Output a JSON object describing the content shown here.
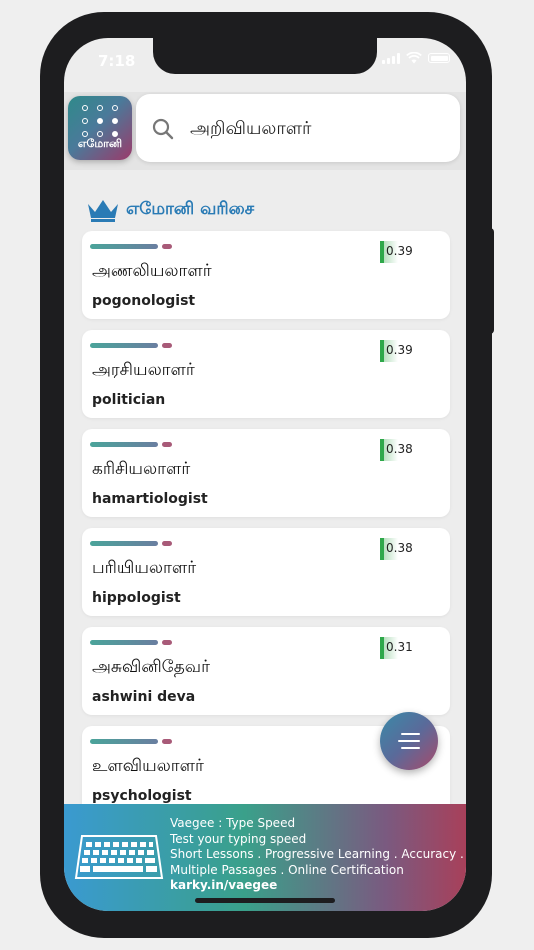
{
  "status_bar": {
    "time": "7:18"
  },
  "app": {
    "logo_text": "எமோனி"
  },
  "search": {
    "value": "அறிவியலாளர்"
  },
  "section": {
    "title": "எமோனி வரிசை"
  },
  "results": [
    {
      "word": "அணலியலாளர்",
      "translation": "pogonologist",
      "score": "0.39"
    },
    {
      "word": "அரசியலாளர்",
      "translation": "politician",
      "score": "0.39"
    },
    {
      "word": "கரிசியலாளர்",
      "translation": "hamartiologist",
      "score": "0.38"
    },
    {
      "word": "பரியியலாளர்",
      "translation": "hippologist",
      "score": "0.38"
    },
    {
      "word": "அசுவினிதேவர்",
      "translation": "ashwini deva",
      "score": "0.31"
    },
    {
      "word": "உளவியலாளர்",
      "translation": "psychologist",
      "score": ""
    }
  ],
  "ad": {
    "line1": "Vaegee : Type Speed",
    "line2": "Test your typing speed",
    "line3": "Short Lessons . Progressive Learning . Accuracy . Speed .",
    "line4": "Multiple Passages . Online Certification",
    "link": "karky.in/vaegee"
  },
  "icons": {
    "search": "search-icon",
    "crown": "crown-icon",
    "fab": "menu-icon",
    "ad": "keyboard-icon"
  },
  "colors": {
    "section_title": "#2a7bb5",
    "score_bar": "#2ea84a",
    "crown": "#2a7bb5"
  }
}
